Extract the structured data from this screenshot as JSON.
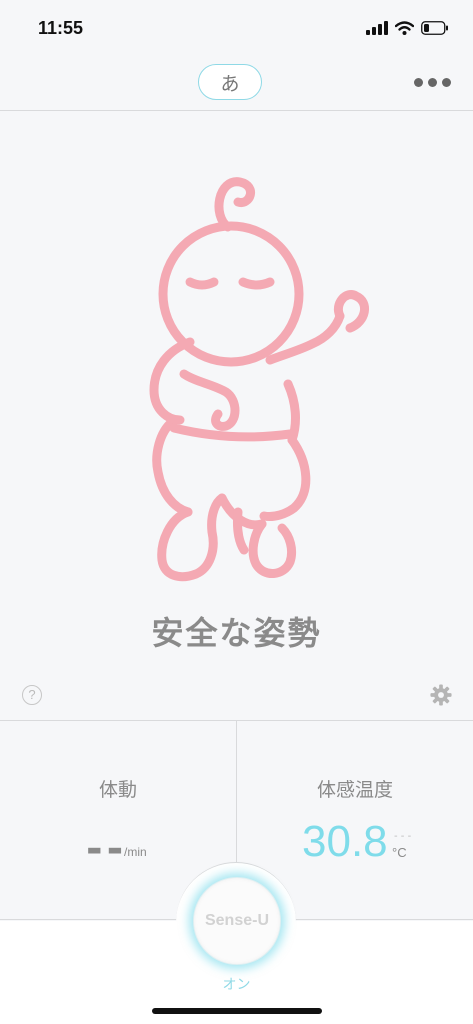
{
  "status_bar": {
    "time": "11:55"
  },
  "header": {
    "profile_initial": "あ"
  },
  "posture": {
    "label": "安全な姿勢"
  },
  "help": {
    "symbol": "?"
  },
  "stats": {
    "movement": {
      "title": "体動",
      "value": "--",
      "unit": "/min"
    },
    "temperature": {
      "title": "体感温度",
      "value": "30.8",
      "trend": "- - -",
      "unit": "°C"
    }
  },
  "device": {
    "name": "Sense-U",
    "status": "オン"
  },
  "colors": {
    "accent": "#7fdcea",
    "baby": "#f4a9b3",
    "text": "#8a8a8a"
  }
}
